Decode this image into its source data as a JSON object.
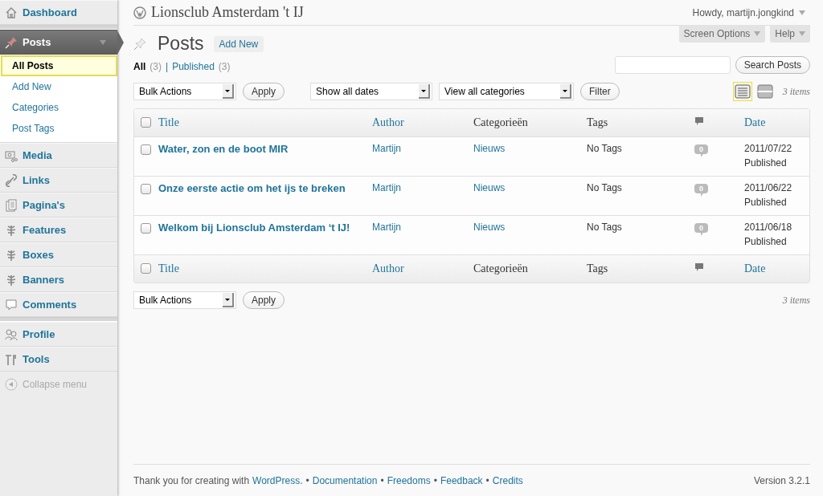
{
  "sidebar": {
    "groups": [
      [
        {
          "label": "Dashboard",
          "selected": false
        }
      ],
      [
        {
          "label": "Posts",
          "selected": true,
          "children": [
            {
              "label": "All Posts",
              "selected": true
            },
            {
              "label": "Add New",
              "selected": false
            },
            {
              "label": "Categories",
              "selected": false
            },
            {
              "label": "Post Tags",
              "selected": false
            }
          ]
        },
        {
          "label": "Media",
          "selected": false
        },
        {
          "label": "Links",
          "selected": false
        },
        {
          "label": "Pagina's",
          "selected": false
        },
        {
          "label": "Features",
          "selected": false
        },
        {
          "label": "Boxes",
          "selected": false
        },
        {
          "label": "Banners",
          "selected": false
        },
        {
          "label": "Comments",
          "selected": false
        }
      ],
      [
        {
          "label": "Profile",
          "selected": false
        },
        {
          "label": "Tools",
          "selected": false
        }
      ]
    ],
    "collapse": "Collapse menu"
  },
  "header": {
    "site_title": "Lionsclub Amsterdam 't IJ",
    "greeting": "Howdy, martijn.jongkind",
    "screen_options": "Screen Options",
    "help": "Help"
  },
  "page": {
    "title": "Posts",
    "add_new": "Add New"
  },
  "filters": {
    "separator": "|",
    "items": [
      {
        "label": "All",
        "count": "(3)",
        "selected": true
      },
      {
        "label": "Published",
        "count": "(3)",
        "selected": false
      }
    ]
  },
  "search": {
    "button": "Search Posts"
  },
  "top_nav": {
    "bulk": "Bulk Actions",
    "apply": "Apply",
    "dates": "Show all dates",
    "categories": "View all categories",
    "filter": "Filter",
    "view_modes": [
      {
        "kind": "list",
        "selected": true
      },
      {
        "kind": "excerpt",
        "selected": false
      }
    ],
    "count": "3 items"
  },
  "table": {
    "header": {
      "checked": false,
      "columns": [
        {
          "label": "Title",
          "kind": "sortable"
        },
        {
          "label": "Author",
          "kind": "sortable"
        },
        {
          "label": "Categorieën",
          "kind": "plain"
        },
        {
          "label": "Tags",
          "kind": "plain"
        },
        {
          "kind": "comments"
        },
        {
          "label": "Date",
          "kind": "sortable"
        }
      ]
    },
    "rows": [
      {
        "checked": false,
        "title": "Water, zon en de boot MIR",
        "author": "Martijn",
        "category": "Nieuws",
        "tags": "No Tags",
        "comments": "0",
        "date": "2011/07/22",
        "status": "Published"
      },
      {
        "checked": false,
        "title": "Onze eerste actie om het ijs te breken",
        "author": "Martijn",
        "category": "Nieuws",
        "tags": "No Tags",
        "comments": "0",
        "date": "2011/06/22",
        "status": "Published"
      },
      {
        "checked": false,
        "title": "Welkom bij Lionsclub Amsterdam ‘t IJ!",
        "author": "Martijn",
        "category": "Nieuws",
        "tags": "No Tags",
        "comments": "0",
        "date": "2011/06/18",
        "status": "Published"
      }
    ],
    "footer": {
      "checked": false,
      "columns": [
        {
          "label": "Title",
          "kind": "sortable"
        },
        {
          "label": "Author",
          "kind": "sortable"
        },
        {
          "label": "Categorieën",
          "kind": "plain"
        },
        {
          "label": "Tags",
          "kind": "plain"
        },
        {
          "kind": "comments"
        },
        {
          "label": "Date",
          "kind": "sortable"
        }
      ]
    }
  },
  "bottom_nav": {
    "bulk": "Bulk Actions",
    "apply": "Apply",
    "count": "3 items"
  },
  "footer": {
    "thanks": "Thank you for creating with",
    "separator": "•",
    "links": [
      "WordPress.",
      "Documentation",
      "Freedoms",
      "Feedback",
      "Credits"
    ],
    "version": "Version 3.2.1"
  }
}
